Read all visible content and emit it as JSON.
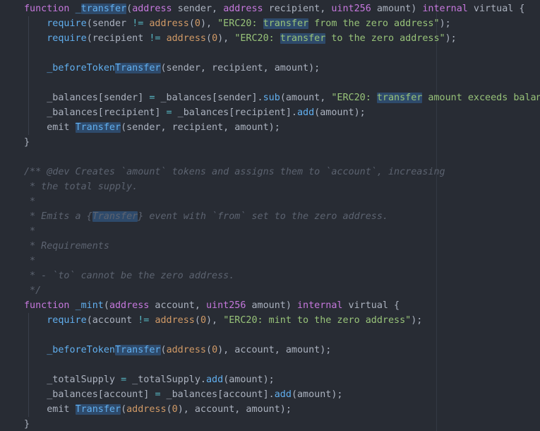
{
  "theme": {
    "background": "#282c34",
    "keyword": "#c678dd",
    "function": "#61afef",
    "operator": "#56b6c2",
    "number_type": "#d19a66",
    "string": "#98c379",
    "comment": "#5c6370",
    "highlight": "#2e4a6b"
  },
  "lines": [
    [
      [
        "function ",
        "k-purple"
      ],
      [
        "_",
        "k-blue"
      ],
      [
        "transfer",
        "k-blue",
        true
      ],
      [
        "(",
        "k-text"
      ],
      [
        "address",
        "k-purple"
      ],
      [
        " sender, ",
        "k-text"
      ],
      [
        "address",
        "k-purple"
      ],
      [
        " recipient, ",
        "k-text"
      ],
      [
        "uint256",
        "k-purple"
      ],
      [
        " amount) ",
        "k-text"
      ],
      [
        "internal",
        "k-purple"
      ],
      [
        " virtual {",
        "k-text"
      ]
    ],
    [
      [
        "    ",
        "k-text"
      ],
      [
        "require",
        "k-blue"
      ],
      [
        "(sender ",
        "k-text"
      ],
      [
        "!=",
        "k-cyan"
      ],
      [
        " ",
        "k-text"
      ],
      [
        "address",
        "k-orange"
      ],
      [
        "(",
        "k-text"
      ],
      [
        "0",
        "k-orange"
      ],
      [
        "), ",
        "k-text"
      ],
      [
        "\"ERC20: ",
        "k-green"
      ],
      [
        "transfer",
        "k-green",
        true
      ],
      [
        " from the zero address\"",
        "k-green"
      ],
      [
        ");",
        "k-text"
      ]
    ],
    [
      [
        "    ",
        "k-text"
      ],
      [
        "require",
        "k-blue"
      ],
      [
        "(recipient ",
        "k-text"
      ],
      [
        "!=",
        "k-cyan"
      ],
      [
        " ",
        "k-text"
      ],
      [
        "address",
        "k-orange"
      ],
      [
        "(",
        "k-text"
      ],
      [
        "0",
        "k-orange"
      ],
      [
        "), ",
        "k-text"
      ],
      [
        "\"ERC20: ",
        "k-green"
      ],
      [
        "transfer",
        "k-green",
        true
      ],
      [
        " to the zero address\"",
        "k-green"
      ],
      [
        ");",
        "k-text"
      ]
    ],
    [],
    [
      [
        "    ",
        "k-text"
      ],
      [
        "_beforeToken",
        "k-blue"
      ],
      [
        "Transfer",
        "k-blue",
        true
      ],
      [
        "(sender, recipient, amount);",
        "k-text"
      ]
    ],
    [],
    [
      [
        "    _balances[sender] ",
        "k-text"
      ],
      [
        "=",
        "k-cyan"
      ],
      [
        " _balances[sender].",
        "k-text"
      ],
      [
        "sub",
        "k-blue"
      ],
      [
        "(amount, ",
        "k-text"
      ],
      [
        "\"ERC20: ",
        "k-green"
      ],
      [
        "transfer",
        "k-green",
        true
      ],
      [
        " amount exceeds balance\"",
        "k-green"
      ],
      [
        ");",
        "k-text"
      ]
    ],
    [
      [
        "    _balances[recipient] ",
        "k-text"
      ],
      [
        "=",
        "k-cyan"
      ],
      [
        " _balances[recipient].",
        "k-text"
      ],
      [
        "add",
        "k-blue"
      ],
      [
        "(amount);",
        "k-text"
      ]
    ],
    [
      [
        "    emit ",
        "k-text"
      ],
      [
        "Transfer",
        "k-blue",
        true
      ],
      [
        "(sender, recipient, amount);",
        "k-text"
      ]
    ],
    [
      [
        "}",
        "k-text"
      ]
    ],
    [],
    [
      [
        "/** @dev Creates `amount` tokens and assigns them to `account`, increasing",
        "k-comment"
      ]
    ],
    [
      [
        " * the total supply.",
        "k-comment"
      ]
    ],
    [
      [
        " *",
        "k-comment"
      ]
    ],
    [
      [
        " * Emits a {",
        "k-comment"
      ],
      [
        "Transfer",
        "k-comment",
        true
      ],
      [
        "} event with `from` set to the zero address.",
        "k-comment"
      ]
    ],
    [
      [
        " *",
        "k-comment"
      ]
    ],
    [
      [
        " * Requirements",
        "k-comment"
      ]
    ],
    [
      [
        " *",
        "k-comment"
      ]
    ],
    [
      [
        " * - `to` cannot be the zero address.",
        "k-comment"
      ]
    ],
    [
      [
        " */",
        "k-comment"
      ]
    ],
    [
      [
        "function ",
        "k-purple"
      ],
      [
        "_mint",
        "k-blue"
      ],
      [
        "(",
        "k-text"
      ],
      [
        "address",
        "k-purple"
      ],
      [
        " account, ",
        "k-text"
      ],
      [
        "uint256",
        "k-purple"
      ],
      [
        " amount) ",
        "k-text"
      ],
      [
        "internal",
        "k-purple"
      ],
      [
        " virtual {",
        "k-text"
      ]
    ],
    [
      [
        "    ",
        "k-text"
      ],
      [
        "require",
        "k-blue"
      ],
      [
        "(account ",
        "k-text"
      ],
      [
        "!=",
        "k-cyan"
      ],
      [
        " ",
        "k-text"
      ],
      [
        "address",
        "k-orange"
      ],
      [
        "(",
        "k-text"
      ],
      [
        "0",
        "k-orange"
      ],
      [
        "), ",
        "k-text"
      ],
      [
        "\"ERC20: mint to the zero address\"",
        "k-green"
      ],
      [
        ");",
        "k-text"
      ]
    ],
    [],
    [
      [
        "    ",
        "k-text"
      ],
      [
        "_beforeToken",
        "k-blue"
      ],
      [
        "Transfer",
        "k-blue",
        true
      ],
      [
        "(",
        "k-text"
      ],
      [
        "address",
        "k-orange"
      ],
      [
        "(",
        "k-text"
      ],
      [
        "0",
        "k-orange"
      ],
      [
        "), account, amount);",
        "k-text"
      ]
    ],
    [],
    [
      [
        "    _totalSupply ",
        "k-text"
      ],
      [
        "=",
        "k-cyan"
      ],
      [
        " _totalSupply.",
        "k-text"
      ],
      [
        "add",
        "k-blue"
      ],
      [
        "(amount);",
        "k-text"
      ]
    ],
    [
      [
        "    _balances[account] ",
        "k-text"
      ],
      [
        "=",
        "k-cyan"
      ],
      [
        " _balances[account].",
        "k-text"
      ],
      [
        "add",
        "k-blue"
      ],
      [
        "(amount);",
        "k-text"
      ]
    ],
    [
      [
        "    emit ",
        "k-text"
      ],
      [
        "Transfer",
        "k-blue",
        true
      ],
      [
        "(",
        "k-text"
      ],
      [
        "address",
        "k-orange"
      ],
      [
        "(",
        "k-text"
      ],
      [
        "0",
        "k-orange"
      ],
      [
        "), account, amount);",
        "k-text"
      ]
    ],
    [
      [
        "}",
        "k-text"
      ]
    ]
  ]
}
